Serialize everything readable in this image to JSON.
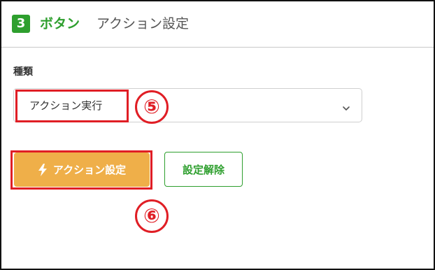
{
  "header": {
    "step_number": "3",
    "title_accent": "ボタン",
    "title_main": "アクション設定"
  },
  "form": {
    "type_label": "種類",
    "type_value": "アクション実行"
  },
  "buttons": {
    "primary_label": "アクション設定",
    "primary_icon": "lightning-icon",
    "secondary_label": "設定解除"
  },
  "annotations": {
    "marker_5": "⑤",
    "marker_6": "⑥"
  },
  "colors": {
    "accent_green": "#2e9f2e",
    "primary_orange": "#efaf49",
    "highlight_red": "#e01e25"
  }
}
